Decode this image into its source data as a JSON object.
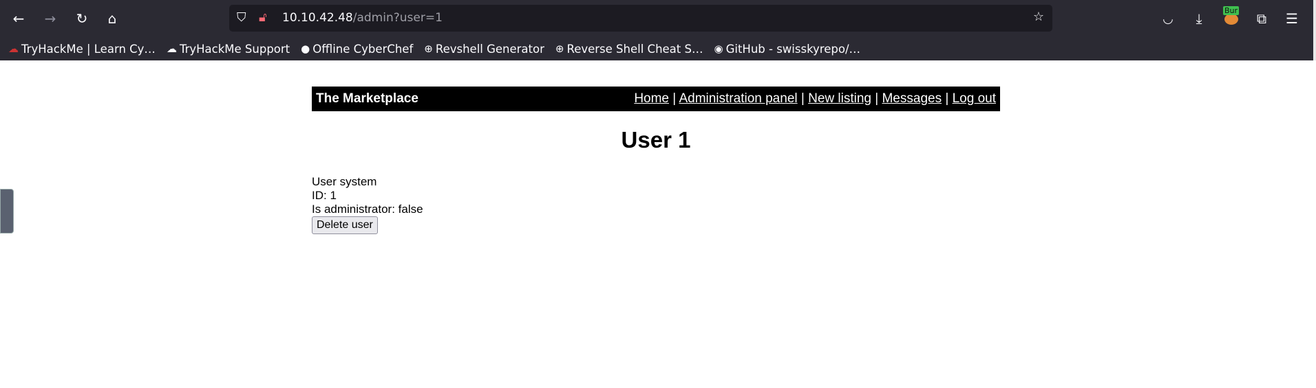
{
  "browser": {
    "url_host": "10.10.42.48",
    "url_path": "/admin?user=1",
    "bookmarks": [
      "TryHackMe | Learn Cy…",
      "TryHackMe Support",
      "Offline CyberChef",
      "Revshell Generator",
      "Reverse Shell Cheat S…",
      "GitHub - swisskyrepo/…"
    ],
    "burp_label": "Bur"
  },
  "site": {
    "brand": "The Marketplace",
    "nav": [
      "Home",
      "Administration panel",
      "New listing",
      "Messages",
      "Log out"
    ],
    "separator": " | "
  },
  "user": {
    "title": "User 1",
    "name_line": "User system",
    "id_line": "ID: 1",
    "admin_line": "Is administrator: false",
    "delete_label": "Delete user"
  }
}
